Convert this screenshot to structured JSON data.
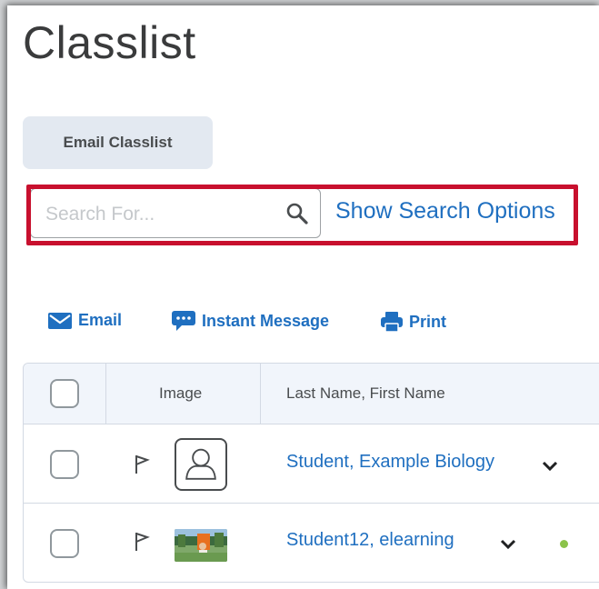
{
  "page": {
    "title": "Classlist"
  },
  "toolbar": {
    "email_classlist_label": "Email Classlist"
  },
  "search": {
    "placeholder": "Search For...",
    "value": "",
    "show_options_label": "Show Search Options"
  },
  "actions": {
    "email_label": "Email",
    "instant_message_label": "Instant Message",
    "print_label": "Print"
  },
  "table": {
    "columns": {
      "image": "Image",
      "name": "Last Name, First Name"
    },
    "rows": [
      {
        "name": "Student, Example Biology"
      },
      {
        "name": "Student12, elearning"
      }
    ]
  },
  "colors": {
    "link": "#1f6fc0",
    "highlight": "#c8102e",
    "online": "#8bc34a",
    "button_bg": "#e3e9f1"
  },
  "icons": [
    "search-icon",
    "mail-icon",
    "chat-icon",
    "printer-icon",
    "flag-icon",
    "user-icon",
    "chevron-down-icon"
  ]
}
